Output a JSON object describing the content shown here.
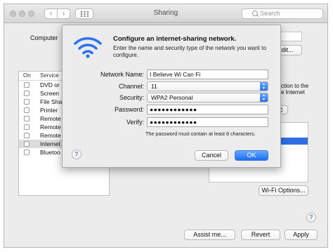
{
  "window": {
    "title": "Sharing",
    "search_placeholder": "Search",
    "nav_back": "‹",
    "nav_forward": "›",
    "grid_icon": "grid-icon"
  },
  "main": {
    "computer_name_label": "Computer",
    "edit_button": "Edit...",
    "services_headers": {
      "on": "On",
      "service": "Service"
    },
    "services": [
      {
        "name": "DVD or",
        "selected": false
      },
      {
        "name": "Screen",
        "selected": false
      },
      {
        "name": "File Sha",
        "selected": false
      },
      {
        "name": "Printer",
        "selected": false
      },
      {
        "name": "Remote",
        "selected": false
      },
      {
        "name": "Remote",
        "selected": false
      },
      {
        "name": "Remote",
        "selected": false
      },
      {
        "name": "Internet",
        "selected": true
      },
      {
        "name": "Bluetoo",
        "selected": false
      }
    ],
    "right_text_line1": "ction to the",
    "right_text_line2": "e Internet",
    "wifi_options_button": "Wi-Fi Options...",
    "help_label": "?",
    "assist_button": "Assist me...",
    "revert_button": "Revert",
    "apply_button": "Apply"
  },
  "sheet": {
    "icon": "wifi-icon",
    "title": "Configure an internet-sharing network.",
    "description": "Enter the name and security type of the network you want to configure.",
    "fields": {
      "network_name_label": "Network Name:",
      "network_name_value": "I Believe Wi Can Fi",
      "channel_label": "Channel:",
      "channel_value": "11",
      "security_label": "Security:",
      "security_value": "WPA2 Personal",
      "password_label": "Password:",
      "password_value": "●●●●●●●●●●●●",
      "verify_label": "Verify:",
      "verify_value": "●●●●●●●●●●●●"
    },
    "password_note": "The password must contain at least 8 characters.",
    "help_label": "?",
    "cancel_button": "Cancel",
    "ok_button": "OK",
    "accent_color": "#2a74ee"
  }
}
